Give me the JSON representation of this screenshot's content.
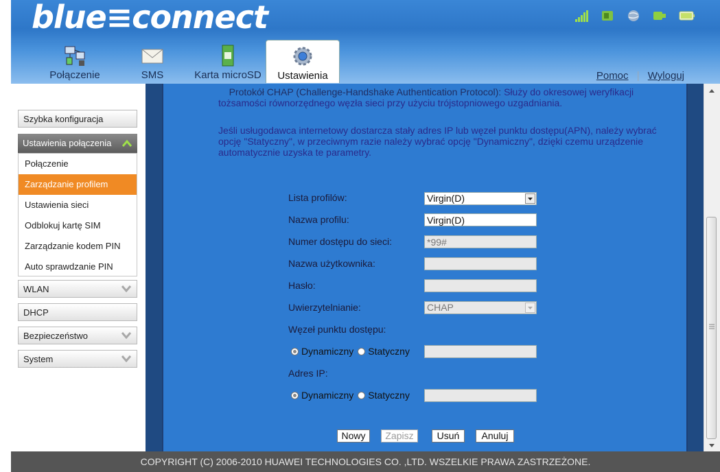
{
  "header": {
    "logo": "blue≡connect",
    "status_icons": [
      "signal-icon",
      "sim-icon",
      "globe-icon",
      "connection-icon",
      "battery-icon"
    ]
  },
  "tabs": [
    {
      "label": "Połączenie",
      "icon": "network-computers-icon"
    },
    {
      "label": "SMS",
      "icon": "envelope-icon"
    },
    {
      "label": "Karta microSD",
      "icon": "sd-card-icon"
    },
    {
      "label": "Ustawienia",
      "icon": "gear-icon",
      "active": true
    }
  ],
  "toplinks": {
    "help": "Pomoc",
    "logout": "Wyloguj"
  },
  "sidebar": {
    "quick_config": "Szybka konfiguracja",
    "conn_settings": "Ustawienia połączenia",
    "sub_items": [
      "Połączenie",
      "Zarządzanie profilem",
      "Ustawienia sieci",
      "Odblokuj kartę SIM",
      "Zarządzanie kodem PIN",
      "Auto sprawdzanie PIN"
    ],
    "active_sub": "Zarządzanie profilem",
    "wlan": "WLAN",
    "dhcp": "DHCP",
    "security": "Bezpieczeństwo",
    "system": "System"
  },
  "help": {
    "chap_lead": "Protokół CHAP (Challenge-Handshake Authentication Protocol):",
    "chap_rest": "Służy do okresowej weryfikacji tożsamości równorzędnego węzła sieci przy użyciu trójstopniowego uzgadniania.",
    "apn_text": "Jeśli usługodawca internetowy dostarcza stały adres IP lub węzeł punktu dostępu(APN), należy wybrać opcję \"Statyczny\", w przeciwnym razie należy wybrać opcję \"Dynamiczny\", dzięki czemu urządzenie automatycznie uzyska te parametry."
  },
  "form": {
    "profile_list_label": "Lista profilów:",
    "profile_list_value": "Virgin(D)",
    "profile_name_label": "Nazwa profilu:",
    "profile_name_value": "Virgin(D)",
    "dial_label": "Numer dostępu do sieci:",
    "dial_value": "*99#",
    "user_label": "Nazwa użytkownika:",
    "user_value": "",
    "password_label": "Hasło:",
    "password_value": "",
    "auth_label": "Uwierzytelnianie:",
    "auth_value": "CHAP",
    "apn_label": "Węzeł punktu dostępu:",
    "apn_dynamic": "Dynamiczny",
    "apn_static": "Statyczny",
    "ip_label": "Adres IP:",
    "ip_dynamic": "Dynamiczny",
    "ip_static": "Statyczny"
  },
  "buttons": {
    "new": "Nowy",
    "save": "Zapisz",
    "delete": "Usuń",
    "cancel": "Anuluj"
  },
  "footer": "COPYRIGHT (C) 2006-2010 HUAWEI TECHNOLOGIES CO. ,LTD. WSZELKIE PRAWA ZASTRZEŻONE.",
  "colors": {
    "header_blue": "#2e77c8",
    "active_orange": "#f08a24",
    "content_blue": "#2e7bd1",
    "help_text": "#2a2a8a"
  }
}
